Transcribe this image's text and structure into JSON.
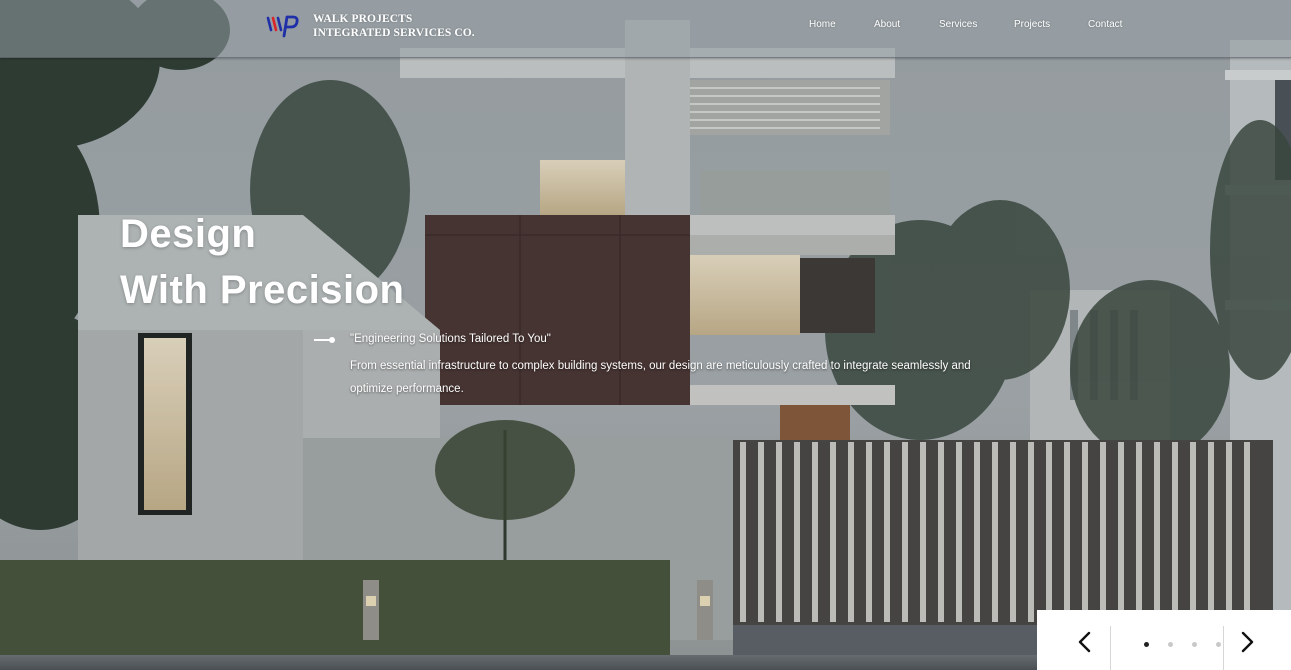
{
  "brand": {
    "name_line1": "WALK PROJECTS",
    "name_line2": "INTEGRATED SERVICES CO.",
    "logo_icon": "wp-monogram-icon",
    "logo_colors": {
      "blue": "#1f2fa8",
      "red": "#d8262b"
    }
  },
  "nav": {
    "items": [
      {
        "label": "Home"
      },
      {
        "label": "About"
      },
      {
        "label": "Services"
      },
      {
        "label": "Projects"
      },
      {
        "label": "Contact"
      }
    ]
  },
  "hero": {
    "title_line1": "Design",
    "title_line2": "With Precision",
    "tagline": "\"Engineering Solutions Tailored To You\"",
    "description": "From essential infrastructure to complex building systems, our design are meticulously crafted to integrate seamlessly and optimize performance."
  },
  "slider": {
    "prev_icon": "chevron-left-icon",
    "next_icon": "chevron-right-icon",
    "slide_count": 4,
    "active_index": 0
  }
}
